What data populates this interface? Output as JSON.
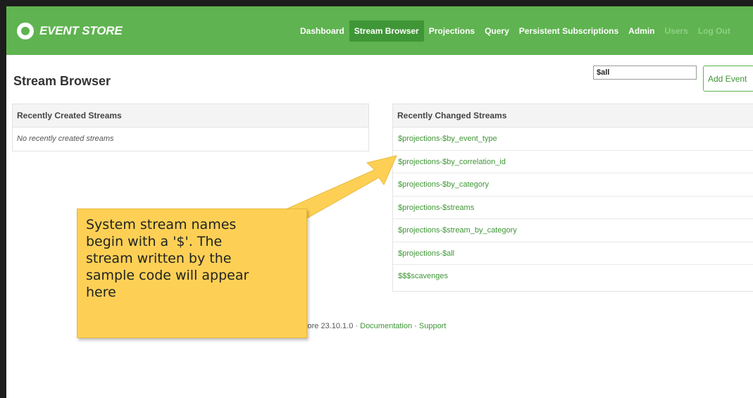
{
  "app": {
    "logo_text": "EVENT STORE"
  },
  "nav": {
    "items": [
      {
        "label": "Dashboard",
        "state": "normal"
      },
      {
        "label": "Stream Browser",
        "state": "active"
      },
      {
        "label": "Projections",
        "state": "normal"
      },
      {
        "label": "Query",
        "state": "normal"
      },
      {
        "label": "Persistent Subscriptions",
        "state": "normal"
      },
      {
        "label": "Admin",
        "state": "normal"
      },
      {
        "label": "Users",
        "state": "muted"
      },
      {
        "label": "Log Out",
        "state": "muted"
      }
    ]
  },
  "page": {
    "title": "Stream Browser",
    "stream_input_value": "$all",
    "add_event_label": "Add Event"
  },
  "recently_created": {
    "header": "Recently Created Streams",
    "empty_text": "No recently created streams"
  },
  "recently_changed": {
    "header": "Recently Changed Streams",
    "streams": [
      "$projections-$by_event_type",
      "$projections-$by_correlation_id",
      "$projections-$by_category",
      "$projections-$streams",
      "$projections-$stream_by_category",
      "$projections-$all",
      "$$$scavenges"
    ]
  },
  "footer": {
    "version_text": "t Store 23.10.1.0 · ",
    "documentation_label": "Documentation",
    "separator": " · ",
    "support_label": "Support"
  },
  "annotation": {
    "text_lines": [
      "System stream names",
      "begin with a '$'. The",
      "stream written by the",
      "sample code will appear",
      "here"
    ]
  },
  "colors": {
    "brand_green": "#5fb350",
    "active_nav_green": "#3f9636",
    "link_green": "#3f9636",
    "callout_yellow": "#fdd055"
  }
}
